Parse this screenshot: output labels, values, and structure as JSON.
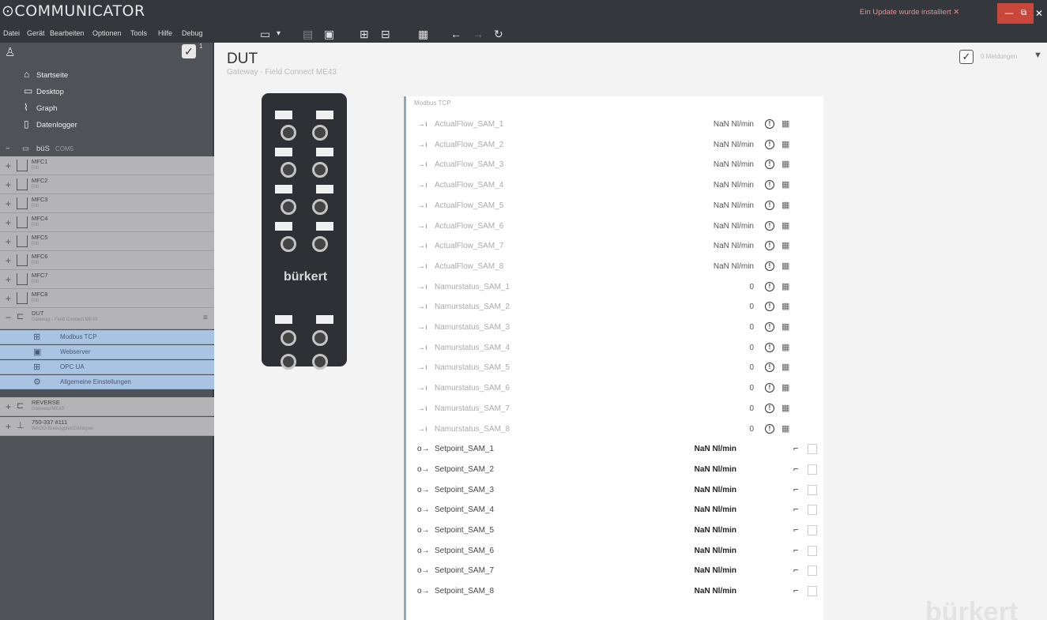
{
  "app": {
    "title": "COMMUNICATOR",
    "update_note": "Ein Update wurde installiert ✕",
    "win_min": "—",
    "win_max": "⧉",
    "win_close": "✕"
  },
  "menu": [
    "Datei",
    "Gerät",
    "Bearbeiten",
    "Optionen",
    "Tools",
    "Hilfe",
    "Debug"
  ],
  "toolbar_icons": [
    "device-view-icon",
    "dropdown-icon",
    "list-icon",
    "save-icon",
    "import-icon",
    "export-icon",
    "document-icon",
    "back-arrow-icon",
    "forward-arrow-icon",
    "refresh-icon"
  ],
  "sidebar": {
    "count": "1",
    "nav": [
      {
        "label": "Startseite",
        "icon": "home-icon"
      },
      {
        "label": "Desktop",
        "icon": "desktop-icon"
      },
      {
        "label": "Graph",
        "icon": "graph-icon"
      },
      {
        "label": "Datenlogger",
        "icon": "datalogger-icon"
      }
    ],
    "bus": {
      "label": "büS",
      "sub": "COM5"
    },
    "mfcs": [
      {
        "name": "MFC1",
        "sub": "PdI"
      },
      {
        "name": "MFC2",
        "sub": "PdI"
      },
      {
        "name": "MFC3",
        "sub": "PdI"
      },
      {
        "name": "MFC4",
        "sub": "PdI"
      },
      {
        "name": "MFC5",
        "sub": "PdI"
      },
      {
        "name": "MFC6",
        "sub": "PdI"
      },
      {
        "name": "MFC7",
        "sub": "PdI"
      },
      {
        "name": "MFC8",
        "sub": "PdI"
      }
    ],
    "dut": {
      "name": "DUT",
      "sub": "Gateway - Field Connect ME43"
    },
    "dut_children": [
      "Modbus TCP",
      "Webserver",
      "OPC UA",
      "Allgemeine Einstellungen"
    ],
    "reverse": {
      "name": "REVERSE",
      "sub": "Gateway/ME43"
    },
    "last": {
      "name": "750-337 #111",
      "sub": "WAGO-Buskoppler/CANopen"
    }
  },
  "main": {
    "title": "DUT",
    "subtitle": "Gateway - Field Connect ME43",
    "messages": "0 Meldungen",
    "brand": "bürkert",
    "panel_title": "Modbus TCP",
    "inputs": [
      {
        "name": "ActualFlow_SAM_1",
        "value": "NaN Nl/min"
      },
      {
        "name": "ActualFlow_SAM_2",
        "value": "NaN Nl/min"
      },
      {
        "name": "ActualFlow_SAM_3",
        "value": "NaN Nl/min"
      },
      {
        "name": "ActualFlow_SAM_4",
        "value": "NaN Nl/min"
      },
      {
        "name": "ActualFlow_SAM_5",
        "value": "NaN Nl/min"
      },
      {
        "name": "ActualFlow_SAM_6",
        "value": "NaN Nl/min"
      },
      {
        "name": "ActualFlow_SAM_7",
        "value": "NaN Nl/min"
      },
      {
        "name": "ActualFlow_SAM_8",
        "value": "NaN Nl/min"
      },
      {
        "name": "Namurstatus_SAM_1",
        "value": "0"
      },
      {
        "name": "Namurstatus_SAM_2",
        "value": "0"
      },
      {
        "name": "Namurstatus_SAM_3",
        "value": "0"
      },
      {
        "name": "Namurstatus_SAM_4",
        "value": "0"
      },
      {
        "name": "Namurstatus_SAM_5",
        "value": "0"
      },
      {
        "name": "Namurstatus_SAM_6",
        "value": "0"
      },
      {
        "name": "Namurstatus_SAM_7",
        "value": "0"
      },
      {
        "name": "Namurstatus_SAM_8",
        "value": "0"
      }
    ],
    "outputs": [
      {
        "name": "Setpoint_SAM_1",
        "value": "NaN Nl/min"
      },
      {
        "name": "Setpoint_SAM_2",
        "value": "NaN Nl/min"
      },
      {
        "name": "Setpoint_SAM_3",
        "value": "NaN Nl/min"
      },
      {
        "name": "Setpoint_SAM_4",
        "value": "NaN Nl/min"
      },
      {
        "name": "Setpoint_SAM_5",
        "value": "NaN Nl/min"
      },
      {
        "name": "Setpoint_SAM_6",
        "value": "NaN Nl/min"
      },
      {
        "name": "Setpoint_SAM_7",
        "value": "NaN Nl/min"
      },
      {
        "name": "Setpoint_SAM_8",
        "value": "NaN Nl/min"
      }
    ],
    "watermark": "bürkert"
  }
}
